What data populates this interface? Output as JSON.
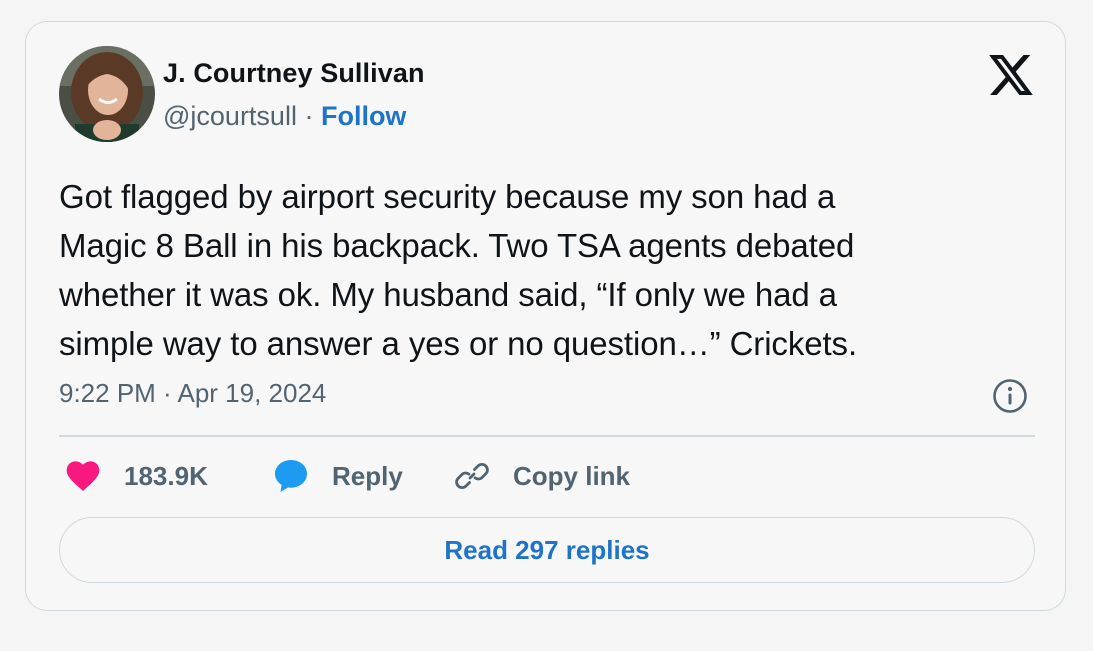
{
  "author": {
    "name": "J. Courtney Sullivan",
    "handle": "@jcourtsull",
    "separator": " · ",
    "follow_label": "Follow",
    "avatar_icon": "profile-photo"
  },
  "tweet": {
    "text": "Got flagged by airport security because my son had a\nMagic 8 Ball in his backpack. Two TSA agents debated\nwhether it was ok. My husband said, “If only we had a\nsimple way to answer a yes or no question…” Crickets.",
    "timestamp": "9:22 PM · Apr 19, 2024"
  },
  "actions": {
    "likes_count": "183.9K",
    "reply_label": "Reply",
    "copy_link_label": "Copy link",
    "read_replies_label": "Read 297 replies"
  },
  "icons": {
    "brand": "x-logo-icon",
    "info": "info-icon",
    "like": "heart-icon",
    "reply": "speech-bubble-icon",
    "copy": "link-icon"
  },
  "colors": {
    "heart": "#f91880",
    "reply_bubble": "#1d9bf0",
    "link_blue": "#1d74c9",
    "secondary_text": "#536471",
    "border": "#cfd9de"
  }
}
